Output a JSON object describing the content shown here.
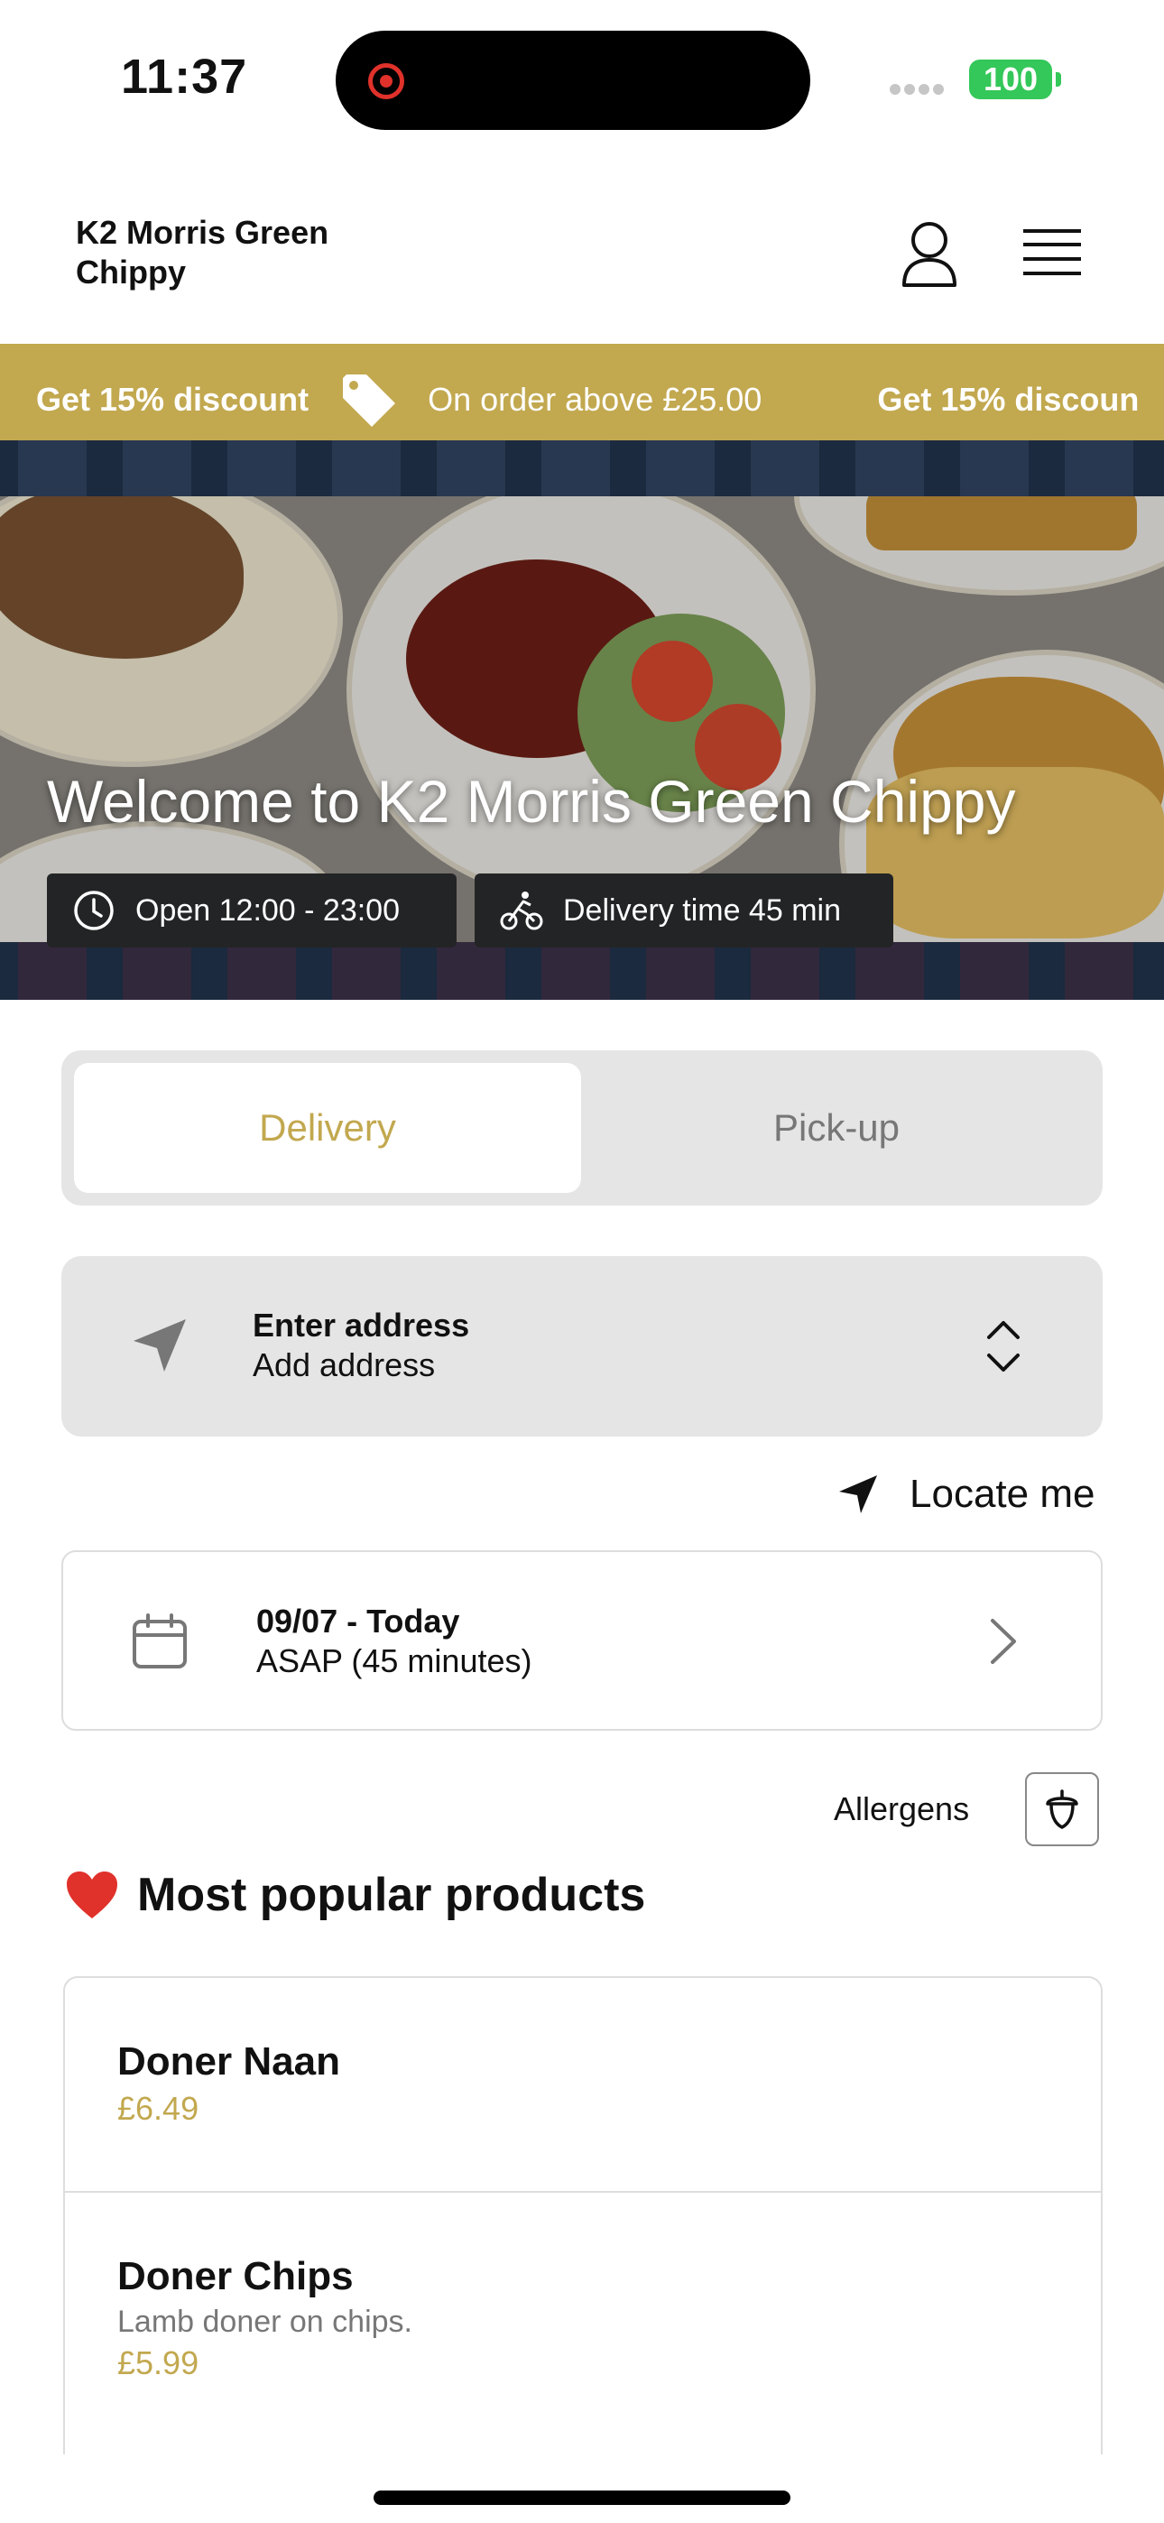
{
  "status_bar": {
    "time": "11:37",
    "battery": "100"
  },
  "header": {
    "brand": "K2 Morris Green Chippy"
  },
  "promo": {
    "strong": "Get 15% discount",
    "text": "On order above £25.00",
    "strong_repeat": "Get 15% discoun"
  },
  "hero": {
    "title": "Welcome to K2 Morris Green Chippy",
    "open_hours": "Open 12:00 - 23:00",
    "delivery_time": "Delivery time 45 min"
  },
  "order_mode": {
    "delivery": "Delivery",
    "pickup": "Pick-up",
    "selected": "Delivery"
  },
  "address": {
    "title": "Enter address",
    "subtitle": "Add address"
  },
  "locate": {
    "label": "Locate me"
  },
  "schedule": {
    "date": "09/07 - Today",
    "time": "ASAP (45 minutes)"
  },
  "allergens": {
    "label": "Allergens"
  },
  "popular": {
    "heading": "Most popular products",
    "items": [
      {
        "name": "Doner Naan",
        "description": "",
        "price": "£6.49"
      },
      {
        "name": "Doner Chips",
        "description": "Lamb doner on chips.",
        "price": "£5.99"
      }
    ]
  },
  "colors": {
    "accent": "#c2a84f",
    "hero_bg": "#1b2a3e",
    "battery": "#34c759"
  }
}
